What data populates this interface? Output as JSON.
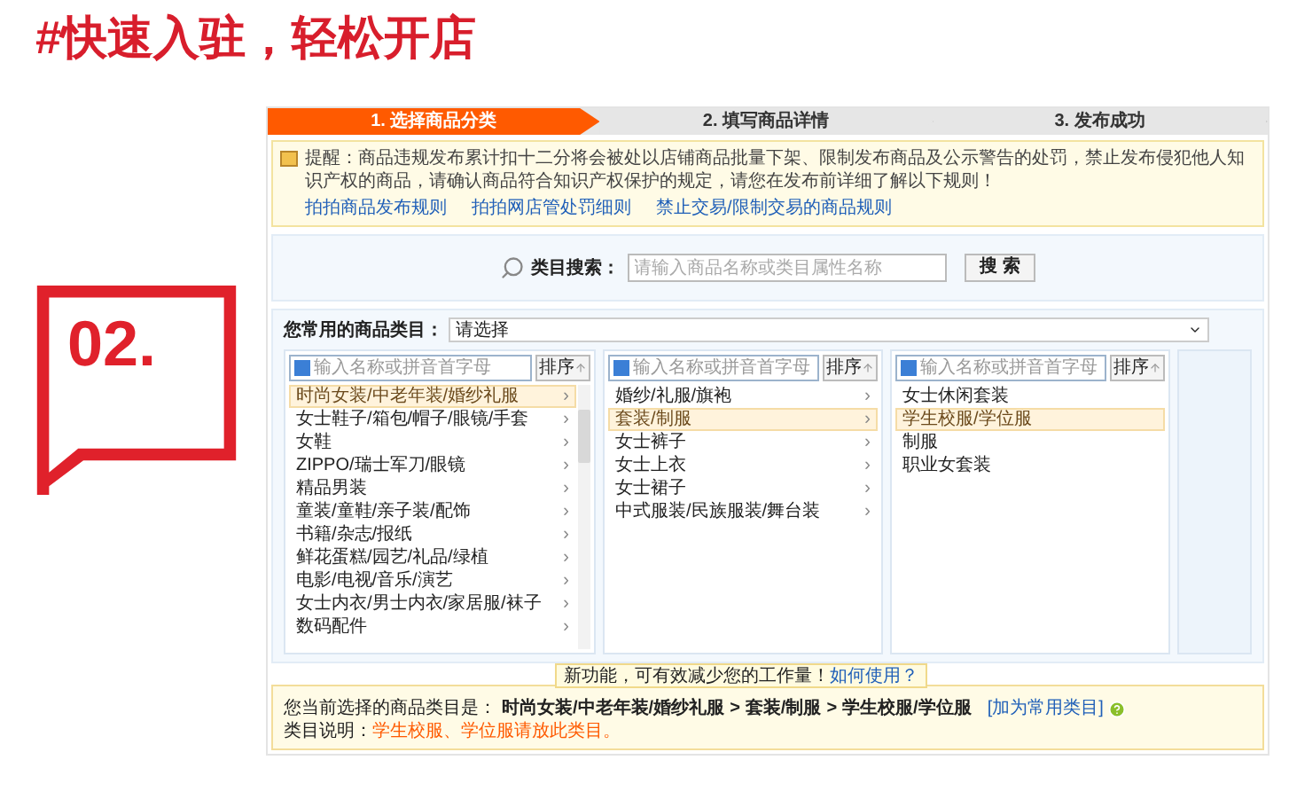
{
  "headline": "#快速入驻，轻松开店",
  "badge": {
    "number": "02."
  },
  "steps": [
    {
      "label": "1. 选择商品分类",
      "selected": true
    },
    {
      "label": "2. 填写商品详情",
      "selected": false
    },
    {
      "label": "3. 发布成功",
      "selected": false
    }
  ],
  "notice": {
    "text": "提醒：商品违规发布累计扣十二分将会被处以店铺商品批量下架、限制发布商品及公示警告的处罚，禁止发布侵犯他人知识产权的商品，请确认商品符合知识产权保护的规定，请您在发布前详细了解以下规则！",
    "links": [
      "拍拍商品发布规则",
      "拍拍网店管处罚细则",
      "禁止交易/限制交易的商品规则"
    ]
  },
  "search": {
    "label": "类目搜索：",
    "placeholder": "请输入商品名称或类目属性名称",
    "button": "搜 索"
  },
  "common_category": {
    "label": "您常用的商品类目：",
    "value": "请选择"
  },
  "columns": [
    {
      "filter_placeholder": "输入名称或拼音首字母",
      "sort_button": "排序",
      "scrollable": true,
      "items": [
        {
          "label": "时尚女装/中老年装/婚纱礼服",
          "arrow": "›",
          "selected": true
        },
        {
          "label": "女士鞋子/箱包/帽子/眼镜/手套",
          "arrow": "›",
          "selected": false
        },
        {
          "label": "女鞋",
          "arrow": "›",
          "selected": false
        },
        {
          "label": "ZIPPO/瑞士军刀/眼镜",
          "arrow": "›",
          "selected": false
        },
        {
          "label": "精品男装",
          "arrow": "›",
          "selected": false
        },
        {
          "label": "童装/童鞋/亲子装/配饰",
          "arrow": "›",
          "selected": false
        },
        {
          "label": "书籍/杂志/报纸",
          "arrow": "›",
          "selected": false
        },
        {
          "label": "鲜花蛋糕/园艺/礼品/绿植",
          "arrow": "›",
          "selected": false
        },
        {
          "label": "电影/电视/音乐/演艺",
          "arrow": "›",
          "selected": false
        },
        {
          "label": "女士内衣/男士内衣/家居服/袜子",
          "arrow": "›",
          "selected": false
        },
        {
          "label": "数码配件",
          "arrow": "›",
          "selected": false
        }
      ]
    },
    {
      "filter_placeholder": "输入名称或拼音首字母",
      "sort_button": "排序",
      "scrollable": false,
      "items": [
        {
          "label": "婚纱/礼服/旗袍",
          "arrow": "›",
          "selected": false
        },
        {
          "label": "套装/制服",
          "arrow": "›",
          "selected": true
        },
        {
          "label": "女士裤子",
          "arrow": "›",
          "selected": false
        },
        {
          "label": "女士上衣",
          "arrow": "›",
          "selected": false
        },
        {
          "label": "女士裙子",
          "arrow": "›",
          "selected": false
        },
        {
          "label": "中式服装/民族服装/舞台装",
          "arrow": "›",
          "selected": false
        }
      ]
    },
    {
      "filter_placeholder": "输入名称或拼音首字母",
      "sort_button": "排序",
      "scrollable": false,
      "items": [
        {
          "label": "女士休闲套装",
          "selected": false
        },
        {
          "label": "学生校服/学位服",
          "selected": true
        },
        {
          "label": "制服",
          "selected": false
        },
        {
          "label": "职业女套装",
          "selected": false
        }
      ]
    }
  ],
  "tooltip": {
    "text": "新功能，可有效减少您的工作量！",
    "link": "如何使用？"
  },
  "selection": {
    "label": "您当前选择的商品类目是：",
    "path": [
      "时尚女装/中老年装/婚纱礼服",
      "套装/制服",
      "学生校服/学位服"
    ],
    "separator": ">",
    "add_link": "[加为常用类目]",
    "note_label": "类目说明：",
    "note": "学生校服、学位服请放此类目。"
  }
}
